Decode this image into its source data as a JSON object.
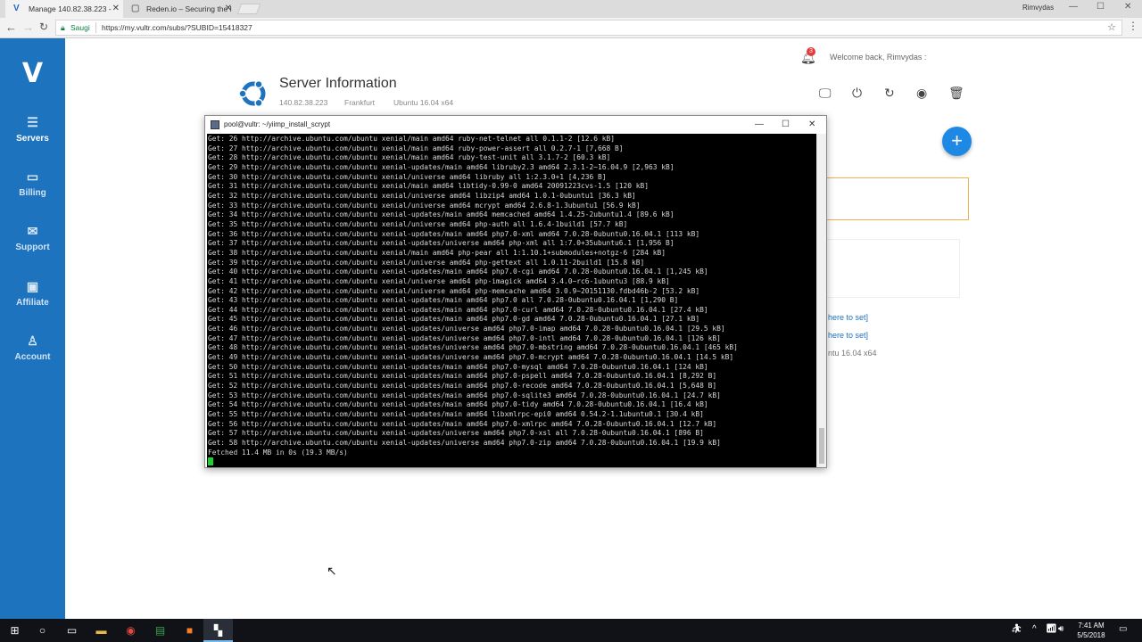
{
  "browser": {
    "tabs": [
      {
        "title": "Manage 140.82.38.223 -",
        "icon": "vultr-icon",
        "active": true
      },
      {
        "title": "Reden.io – Securing the I",
        "icon": "page-icon",
        "active": false
      }
    ],
    "window_user": "Rimvydas",
    "secure_label": "Saugi",
    "url": "https://my.vultr.com/subs/?SUBID=15418327"
  },
  "sidebar": {
    "logo": "V",
    "items": [
      {
        "label": "Servers",
        "icon": "server-icon",
        "active": true
      },
      {
        "label": "Billing",
        "icon": "billing-icon",
        "active": false
      },
      {
        "label": "Support",
        "icon": "envelope-icon",
        "active": false
      },
      {
        "label": "Affiliate",
        "icon": "affiliate-icon",
        "active": false
      },
      {
        "label": "Account",
        "icon": "user-icon",
        "active": false
      }
    ]
  },
  "header": {
    "notification_count": "3",
    "welcome": "Welcome back, Rimvydas :"
  },
  "server": {
    "title": "Server Information",
    "ip": "140.82.38.223",
    "location": "Frankfurt",
    "os": "Ubuntu 16.04 x64",
    "partial_links": [
      "here to set]",
      "here to set]"
    ],
    "partial_os": "ntu 16.04 x64"
  },
  "terminal": {
    "title": "pool@vultr: ~/yiimp_install_scrypt",
    "lines": [
      "Get: 26 http://archive.ubuntu.com/ubuntu xenial/main amd64 ruby-net-telnet all 0.1.1-2 [12.6 kB]",
      "Get: 27 http://archive.ubuntu.com/ubuntu xenial/main amd64 ruby-power-assert all 0.2.7-1 [7,668 B]",
      "Get: 28 http://archive.ubuntu.com/ubuntu xenial/main amd64 ruby-test-unit all 3.1.7-2 [60.3 kB]",
      "Get: 29 http://archive.ubuntu.com/ubuntu xenial-updates/main amd64 libruby2.3 amd64 2.3.1-2~16.04.9 [2,963 kB]",
      "Get: 30 http://archive.ubuntu.com/ubuntu xenial/universe amd64 libruby all 1:2.3.0+1 [4,236 B]",
      "Get: 31 http://archive.ubuntu.com/ubuntu xenial/main amd64 libtidy-0.99-0 amd64 20091223cvs-1.5 [120 kB]",
      "Get: 32 http://archive.ubuntu.com/ubuntu xenial/universe amd64 libzip4 amd64 1.0.1-0ubuntu1 [36.3 kB]",
      "Get: 33 http://archive.ubuntu.com/ubuntu xenial/universe amd64 mcrypt amd64 2.6.8-1.3ubuntu1 [56.9 kB]",
      "Get: 34 http://archive.ubuntu.com/ubuntu xenial-updates/main amd64 memcached amd64 1.4.25-2ubuntu1.4 [89.6 kB]",
      "Get: 35 http://archive.ubuntu.com/ubuntu xenial/universe amd64 php-auth all 1.6.4-1build1 [57.7 kB]",
      "Get: 36 http://archive.ubuntu.com/ubuntu xenial-updates/main amd64 php7.0-xml amd64 7.0.28-0ubuntu0.16.04.1 [113 kB]",
      "Get: 37 http://archive.ubuntu.com/ubuntu xenial-updates/universe amd64 php-xml all 1:7.0+35ubuntu6.1 [1,956 B]",
      "Get: 38 http://archive.ubuntu.com/ubuntu xenial/main amd64 php-pear all 1:1.10.1+submodules+notgz-6 [284 kB]",
      "Get: 39 http://archive.ubuntu.com/ubuntu xenial/universe amd64 php-gettext all 1.0.11-2build1 [15.8 kB]",
      "Get: 40 http://archive.ubuntu.com/ubuntu xenial-updates/main amd64 php7.0-cgi amd64 7.0.28-0ubuntu0.16.04.1 [1,245 kB]",
      "Get: 41 http://archive.ubuntu.com/ubuntu xenial/universe amd64 php-imagick amd64 3.4.0~rc6-1ubuntu3 [88.9 kB]",
      "Get: 42 http://archive.ubuntu.com/ubuntu xenial/universe amd64 php-memcache amd64 3.0.9~20151130.fdbd46b-2 [53.2 kB]",
      "Get: 43 http://archive.ubuntu.com/ubuntu xenial-updates/main amd64 php7.0 all 7.0.28-0ubuntu0.16.04.1 [1,290 B]",
      "Get: 44 http://archive.ubuntu.com/ubuntu xenial-updates/main amd64 php7.0-curl amd64 7.0.28-0ubuntu0.16.04.1 [27.4 kB]",
      "Get: 45 http://archive.ubuntu.com/ubuntu xenial-updates/main amd64 php7.0-gd amd64 7.0.28-0ubuntu0.16.04.1 [27.1 kB]",
      "Get: 46 http://archive.ubuntu.com/ubuntu xenial-updates/universe amd64 php7.0-imap amd64 7.0.28-0ubuntu0.16.04.1 [29.5 kB]",
      "Get: 47 http://archive.ubuntu.com/ubuntu xenial-updates/universe amd64 php7.0-intl amd64 7.0.28-0ubuntu0.16.04.1 [126 kB]",
      "Get: 48 http://archive.ubuntu.com/ubuntu xenial-updates/universe amd64 php7.0-mbstring amd64 7.0.28-0ubuntu0.16.04.1 [465 kB]",
      "Get: 49 http://archive.ubuntu.com/ubuntu xenial-updates/universe amd64 php7.0-mcrypt amd64 7.0.28-0ubuntu0.16.04.1 [14.5 kB]",
      "Get: 50 http://archive.ubuntu.com/ubuntu xenial-updates/main amd64 php7.0-mysql amd64 7.0.28-0ubuntu0.16.04.1 [124 kB]",
      "Get: 51 http://archive.ubuntu.com/ubuntu xenial-updates/main amd64 php7.0-pspell amd64 7.0.28-0ubuntu0.16.04.1 [8,292 B]",
      "Get: 52 http://archive.ubuntu.com/ubuntu xenial-updates/main amd64 php7.0-recode amd64 7.0.28-0ubuntu0.16.04.1 [5,648 B]",
      "Get: 53 http://archive.ubuntu.com/ubuntu xenial-updates/main amd64 php7.0-sqlite3 amd64 7.0.28-0ubuntu0.16.04.1 [24.7 kB]",
      "Get: 54 http://archive.ubuntu.com/ubuntu xenial-updates/main amd64 php7.0-tidy amd64 7.0.28-0ubuntu0.16.04.1 [16.4 kB]",
      "Get: 55 http://archive.ubuntu.com/ubuntu xenial-updates/main amd64 libxmlrpc-epi0 amd64 0.54.2-1.1ubuntu0.1 [30.4 kB]",
      "Get: 56 http://archive.ubuntu.com/ubuntu xenial-updates/main amd64 php7.0-xmlrpc amd64 7.0.28-0ubuntu0.16.04.1 [12.7 kB]",
      "Get: 57 http://archive.ubuntu.com/ubuntu xenial-updates/universe amd64 php7.0-xsl all 7.0.28-0ubuntu0.16.04.1 [896 B]",
      "Get: 58 http://archive.ubuntu.com/ubuntu xenial-updates/universe amd64 php7.0-zip amd64 7.0.28-0ubuntu0.16.04.1 [19.9 kB]",
      "Fetched 11.4 MB in 0s (19.3 MB/s)"
    ]
  },
  "taskbar": {
    "time": "7:41 AM",
    "date": "5/5/2018"
  },
  "colors": {
    "sidebar": "#1e73be",
    "fab": "#1e88e5",
    "notification": "#e23b3b",
    "cursor": "#1fcf34"
  }
}
